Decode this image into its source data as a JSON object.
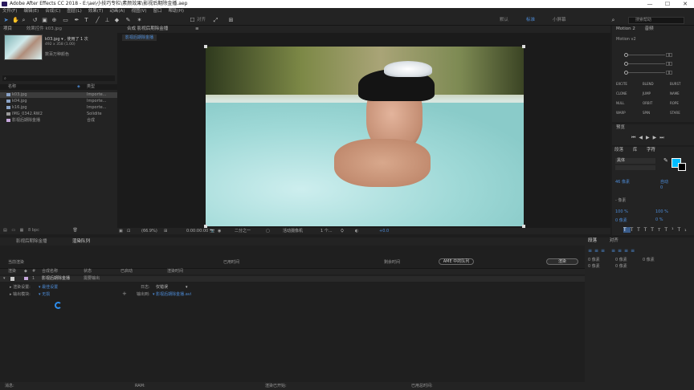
{
  "window": {
    "title": "Adobe After Effects CC 2018 - E:\\ae\\小技巧专栏\\素颜效果\\影视后期除金播.aep",
    "min": "—",
    "max": "☐",
    "close": "✕"
  },
  "menu": [
    "文件(F)",
    "编辑(E)",
    "合成(C)",
    "图层(L)",
    "效果(T)",
    "动画(A)",
    "视图(V)",
    "窗口",
    "帮助(H)"
  ],
  "toolbar": {
    "align_label": "对齐",
    "workspace": [
      "默认",
      "标准",
      "小屏幕"
    ],
    "search_placeholder": "搜索帮助"
  },
  "project": {
    "tab_project": "项目",
    "tab_effects": "效果控件 k03.jpg",
    "selected_name": "k03.jpg ▾ , 使用了 1 次",
    "selected_dims": "492 x 358 (1.00)",
    "selected_note": "数百万种颜色",
    "col_name": "名称",
    "col_type": "类型",
    "items": [
      {
        "name": "k03.jpg",
        "type": "Importe..."
      },
      {
        "name": "k04.jpg",
        "type": "Importe..."
      },
      {
        "name": "k16.jpg",
        "type": "Importe..."
      },
      {
        "name": "IMG_0342.RW2",
        "type": "Solidite"
      },
      {
        "name": "影视后期除金播",
        "type": "合成"
      }
    ],
    "bpc": "8 bpc"
  },
  "comp": {
    "header": "合成 影视后期除金播",
    "tab": "影视后期除金播",
    "zoom": "(66.9%)",
    "timecode": "0:00:00:00",
    "resolution": "二分之一",
    "camera": "活动摄像机",
    "views": "1 个...",
    "offset": "+0.0"
  },
  "right": {
    "motion_title": "Motion 2",
    "motion_tab2": "音频",
    "motion_ver": "Motion v2",
    "params": [
      "0",
      "0",
      "0",
      "0"
    ],
    "fx": [
      "EXCITE",
      "BLEND",
      "BURST",
      "CLONE",
      "JUMP",
      "NAME",
      "NULL",
      "ORBIT",
      "ROPE",
      "WARP",
      "SPIN",
      "STARE"
    ],
    "preview_title": "预览",
    "char_tabs": [
      "段落",
      "库",
      "字符"
    ],
    "font": "黑体",
    "size1": "46 像素",
    "lead": "自动",
    "kern": "0",
    "track": "0",
    "stroke": "- 像素",
    "vscale": "100 %",
    "hscale": "100 %",
    "baseline": "0 像素",
    "tsume": "0 %",
    "align_title": "段落",
    "align_tab2": "对齐",
    "indent": [
      "0 像素",
      "0 像素",
      "0 像素",
      "0 像素",
      "0 像素"
    ]
  },
  "timeline": {
    "tab1": "影视后期除金播",
    "tab2": "渲染队列",
    "current_render": "当前渲染",
    "elapsed": "已用时间",
    "remain": "剩余时间",
    "ame_btn": "AME 中的队列",
    "render_btn": "渲染",
    "cols": [
      "渲染",
      "",
      "#",
      "合成名称",
      "状态",
      "已启动",
      "渲染时间"
    ],
    "item_num": "1",
    "item_name": "影视后期除金播",
    "item_status": "需要输出",
    "settings_label": "渲染设置:",
    "settings_value": "最佳设置",
    "output_label": "输出模块:",
    "output_value": "无损",
    "log_label": "日志:",
    "log_value": "仅错误",
    "out_to_label": "输出到:",
    "out_to_value": "影视后期除金播.avi"
  },
  "status": {
    "msg": "消息:",
    "ram": "RAM:",
    "started": "渲染已开始:",
    "total": "已用总时间:"
  },
  "colors": {
    "accent": "#2d8ceb",
    "swatch": "#00bcff"
  }
}
